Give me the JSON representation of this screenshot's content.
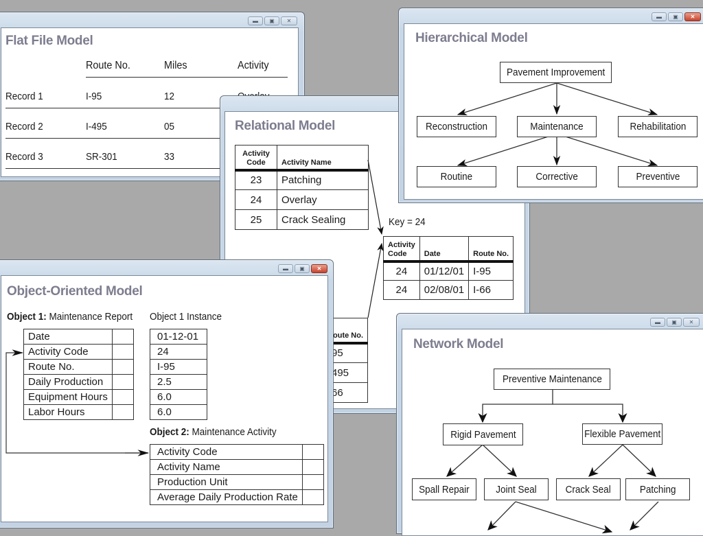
{
  "window_controls": {
    "minimize": "minimize-icon",
    "maximize": "maximize-icon",
    "close": "close-icon"
  },
  "flat_file": {
    "title": "Flat File Model",
    "columns": [
      "Route No.",
      "Miles",
      "Activity"
    ],
    "records": [
      {
        "label": "Record 1",
        "route": "I-95",
        "miles": "12",
        "activity": "Overlay"
      },
      {
        "label": "Record 2",
        "route": "I-495",
        "miles": "05",
        "activity": ""
      },
      {
        "label": "Record 3",
        "route": "SR-301",
        "miles": "33",
        "activity": ""
      }
    ]
  },
  "relational": {
    "title": "Relational Model",
    "activity_table": {
      "headers": [
        "Activity Code",
        "Activity Name"
      ],
      "rows": [
        [
          "23",
          "Patching"
        ],
        [
          "24",
          "Overlay"
        ],
        [
          "25",
          "Crack Sealing"
        ]
      ]
    },
    "key_label": "Key = 24",
    "key_table": {
      "headers": [
        "Activity Code",
        "Date",
        "Route No."
      ],
      "rows": [
        [
          "24",
          "01/12/01",
          "I-95"
        ],
        [
          "24",
          "02/08/01",
          "I-66"
        ]
      ]
    },
    "partial_table": {
      "headers": [
        "oute No."
      ],
      "rows": [
        [
          "95"
        ],
        [
          "495"
        ],
        [
          "66"
        ]
      ]
    }
  },
  "hierarchical": {
    "title": "Hierarchical Model",
    "root": "Pavement Improvement",
    "level1": [
      "Reconstruction",
      "Maintenance",
      "Rehabilitation"
    ],
    "level2": [
      "Routine",
      "Corrective",
      "Preventive"
    ]
  },
  "object_oriented": {
    "title": "Object-Oriented Model",
    "object1_label_bold": "Object 1:",
    "object1_label": "Maintenance Report",
    "object1_fields": [
      "Date",
      "Activity Code",
      "Route No.",
      "Daily Production",
      "Equipment Hours",
      "Labor Hours"
    ],
    "instance_label": "Object 1 Instance",
    "instance_values": [
      "01-12-01",
      "24",
      "I-95",
      "2.5",
      "6.0",
      "6.0"
    ],
    "object2_label_bold": "Object 2:",
    "object2_label": "Maintenance Activity",
    "object2_fields": [
      "Activity Code",
      "Activity Name",
      "Production Unit",
      "Average Daily Production Rate"
    ]
  },
  "network": {
    "title": "Network Model",
    "root": "Preventive Maintenance",
    "level1": [
      "Rigid Pavement",
      "Flexible Pavement"
    ],
    "level2": [
      "Spall Repair",
      "Joint Seal",
      "Crack Seal",
      "Patching"
    ]
  }
}
